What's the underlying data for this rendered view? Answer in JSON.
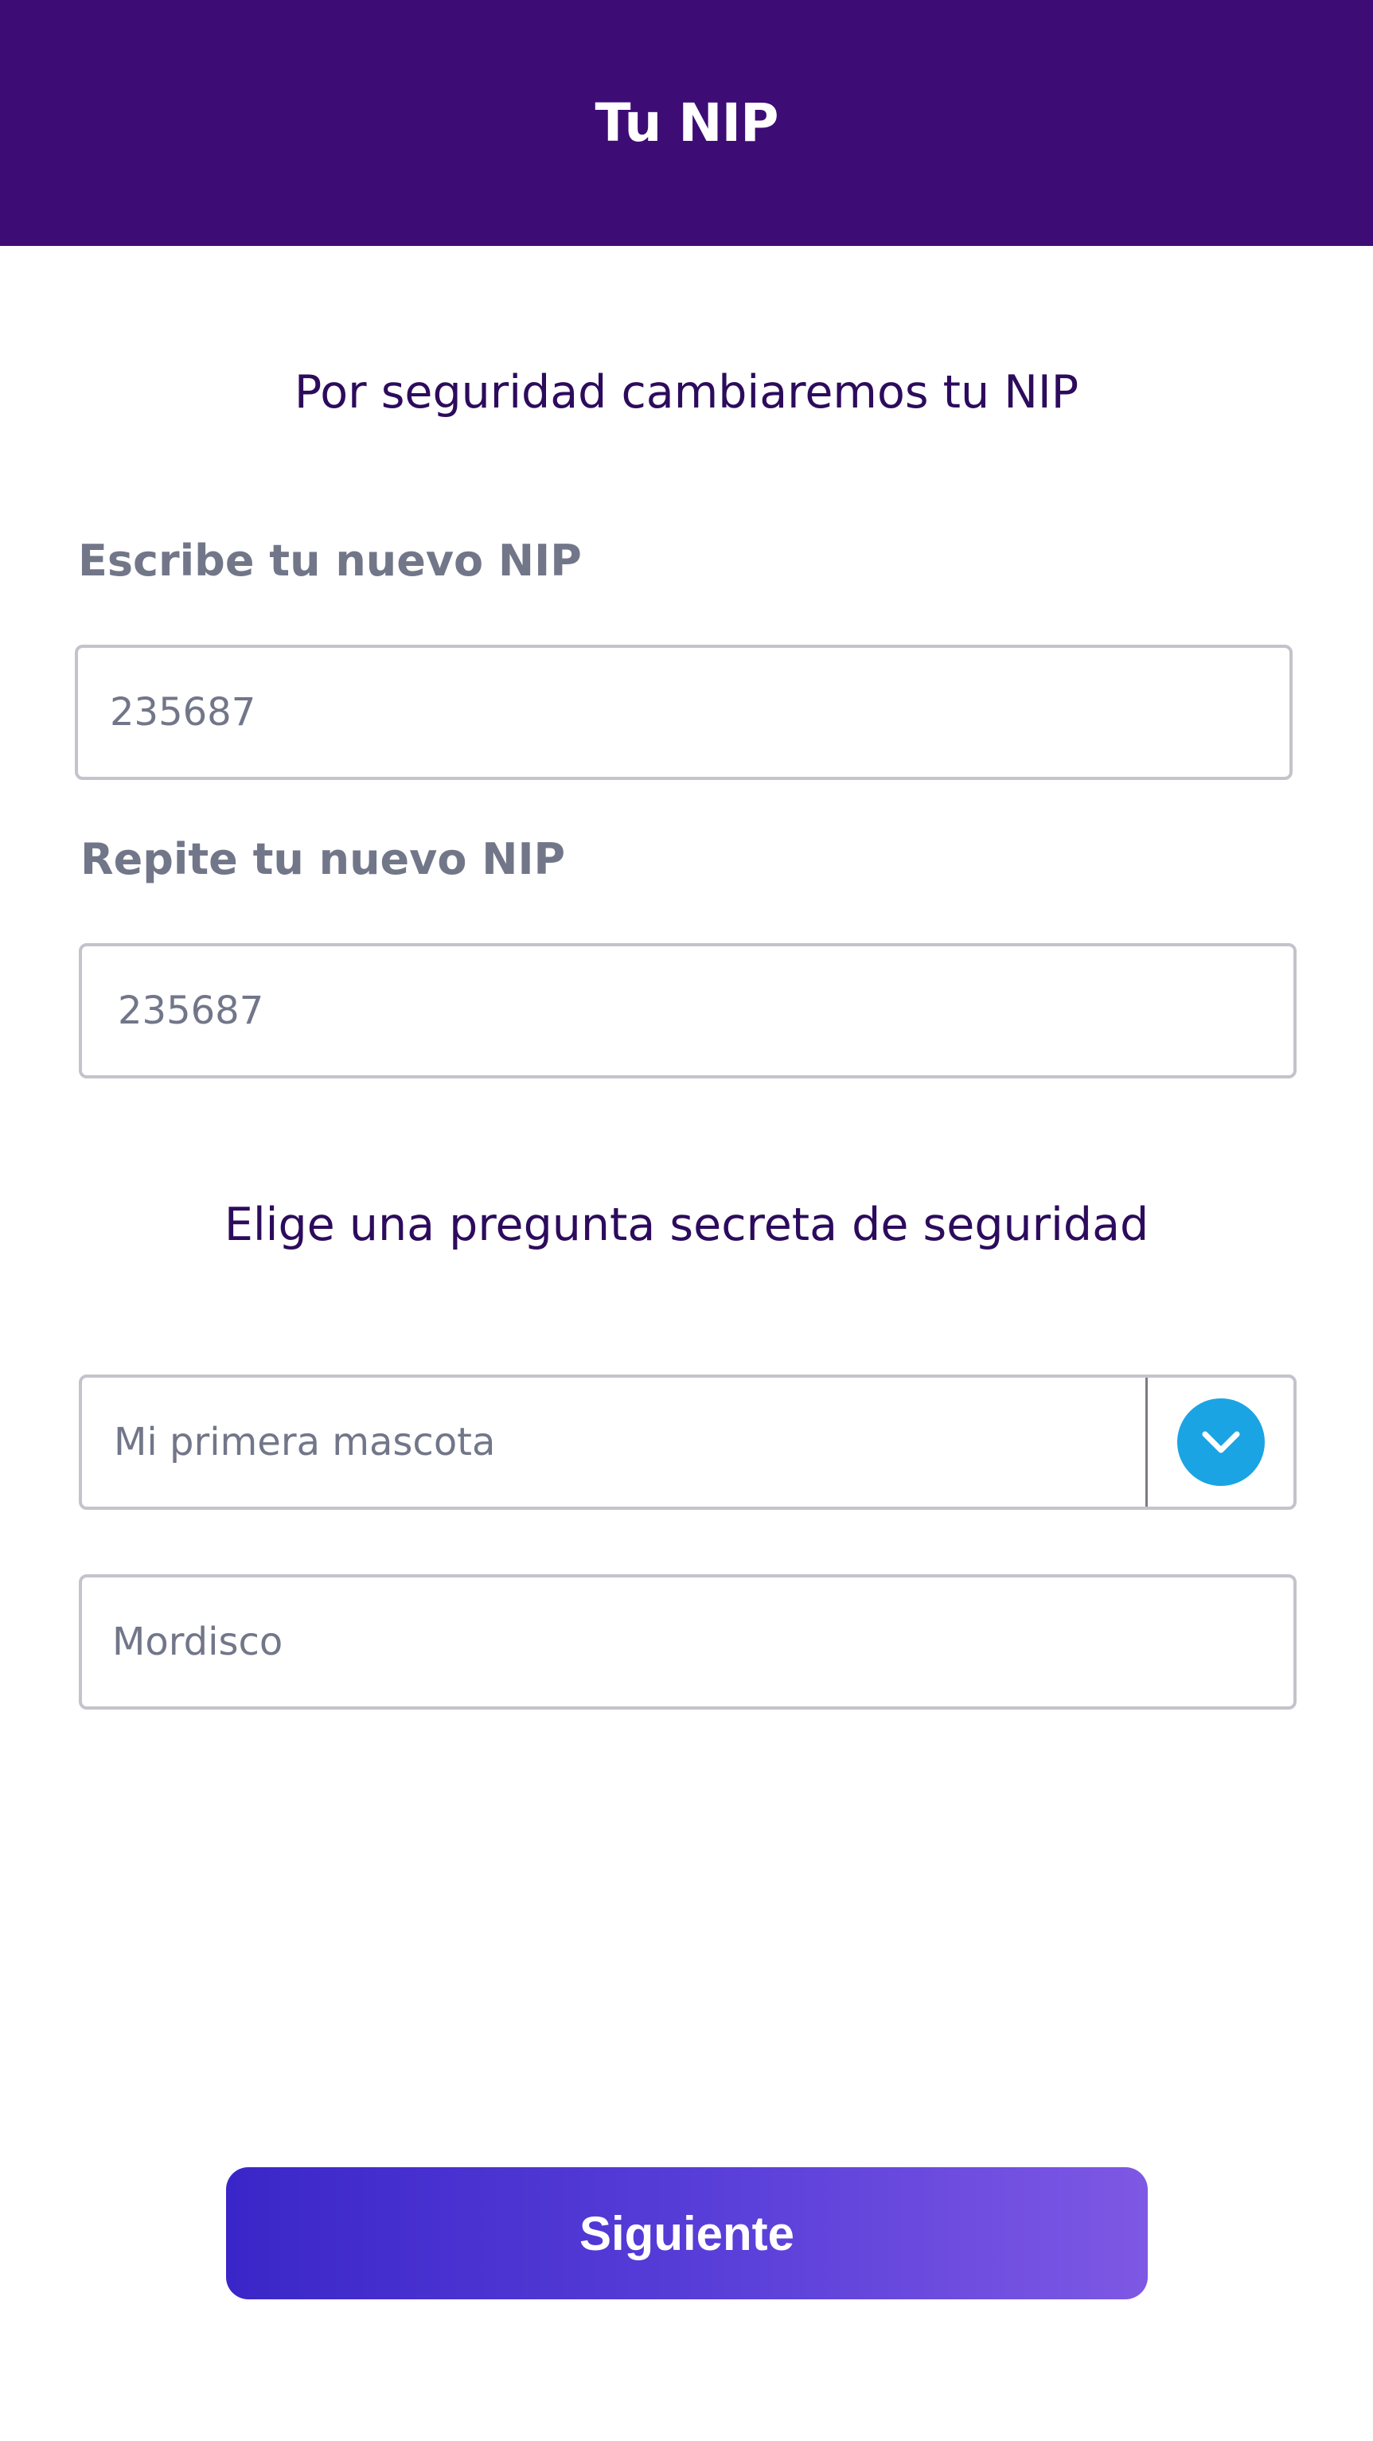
{
  "header": {
    "title": "Tu NIP"
  },
  "main": {
    "intro_text": "Por seguridad cambiaremos tu NIP",
    "new_pin": {
      "label": "Escribe tu nuevo NIP",
      "value": "235687"
    },
    "repeat_pin": {
      "label": "Repite tu nuevo NIP",
      "value": "235687"
    },
    "security_heading": "Elige una pregunta secreta de seguridad",
    "security_question": {
      "selected": "Mi primera mascota",
      "toggle_icon": "chevron-down-icon"
    },
    "security_answer": {
      "value": "Mordisco"
    },
    "next_button": {
      "label": "Siguiente"
    }
  },
  "colors": {
    "header_bg": "#3d0c75",
    "heading_text": "#2d0b5c",
    "label_text": "#727689",
    "dropdown_accent": "#1ba4e3",
    "button_gradient_start": "#3a26c8",
    "button_gradient_end": "#7e58e4"
  }
}
